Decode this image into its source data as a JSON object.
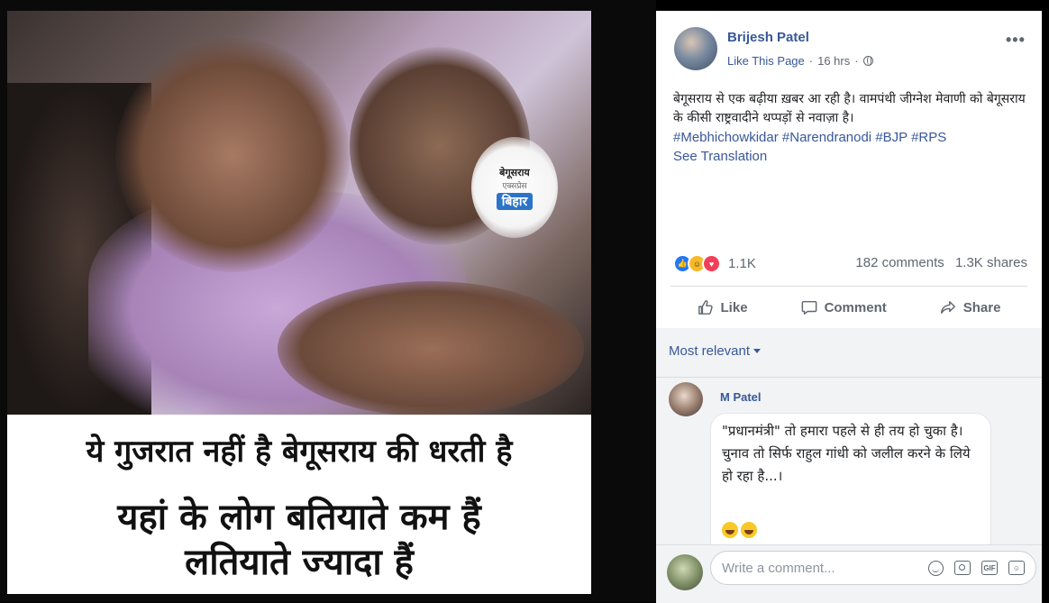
{
  "photo": {
    "badge_line1": "बेगूसराय",
    "badge_line2": "एक्सप्रेस",
    "badge_line3": "बिहार",
    "caption_line1": "ये गुजरात नहीं है बेगूसराय की धरती है",
    "caption_line2": "यहां के लोग बतियाते कम हैं",
    "caption_line3": "लतियाते ज्यादा हैं"
  },
  "post": {
    "author": "Brijesh Patel",
    "like_page": "Like This Page",
    "time": "16 hrs",
    "separator": "·",
    "text": "बेगूसराय से एक बढ़ीया ख़बर आ रही है। वामपंथी जीग्नेश मेवाणी को बेगूसराय के कीसी राष्ट्रवादीने थप्पड़ों से नवाज़ा है।",
    "hashtags": [
      "#Mebhichowkidar",
      "#Narendranodi",
      "#BJP",
      "#RPS"
    ],
    "see_translation": "See Translation",
    "reaction_count": "1.1K",
    "comments_count": "182 comments",
    "shares_count": "1.3K shares"
  },
  "actions": {
    "like": "Like",
    "comment": "Comment",
    "share": "Share"
  },
  "comments": {
    "sort_label": "Most relevant",
    "items": [
      {
        "author": "M Patel",
        "line1": "\"प्रधानमंत्री\" तो हमारा पहले से ही तय हो चुका है।",
        "line2": "चुनाव तो सिर्फ राहुल गांधी को जलील करने के लिये हो रहा है...।"
      }
    ],
    "write_placeholder": "Write a comment...",
    "gif_label": "GIF"
  },
  "colors": {
    "link": "#385898",
    "text": "#1c1e21",
    "muted": "#606770"
  }
}
